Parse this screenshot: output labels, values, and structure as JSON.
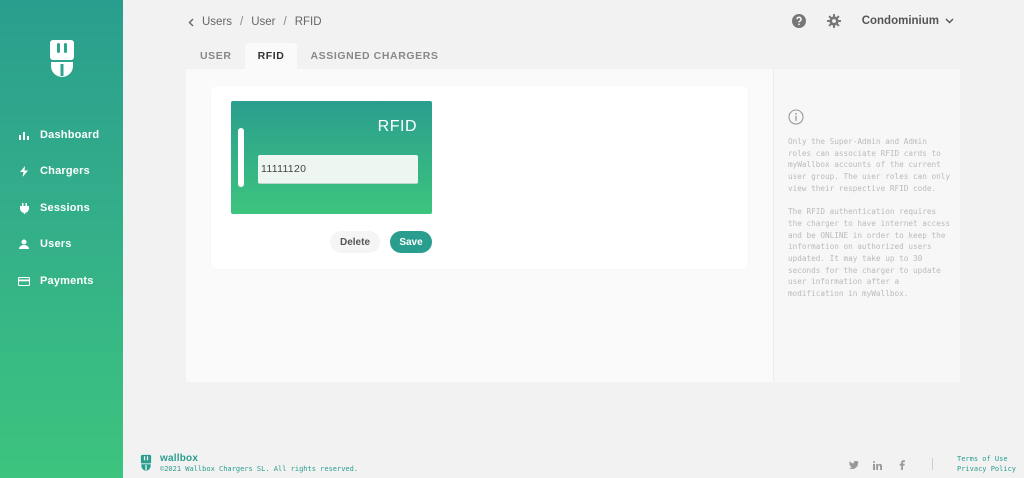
{
  "colors": {
    "brand": "#2a9e8e",
    "brand_light": "#3dc47e",
    "bg": "#f2f2f2"
  },
  "sidebar": {
    "logo_icon": "wallbox-plug-logo",
    "items": [
      {
        "label": "Dashboard",
        "icon": "bar-chart-icon"
      },
      {
        "label": "Chargers",
        "icon": "bolt-icon"
      },
      {
        "label": "Sessions",
        "icon": "plug-icon"
      },
      {
        "label": "Users",
        "icon": "user-icon"
      },
      {
        "label": "Payments",
        "icon": "credit-card-icon"
      }
    ]
  },
  "breadcrumb": {
    "items": [
      "Users",
      "User",
      "RFID"
    ],
    "separator": "/"
  },
  "header": {
    "org_name": "Condominium"
  },
  "tabs": [
    {
      "label": "USER",
      "active": false
    },
    {
      "label": "RFID",
      "active": true
    },
    {
      "label": "ASSIGNED CHARGERS",
      "active": false
    }
  ],
  "rfid": {
    "card_title": "RFID",
    "code_value": "11111120",
    "delete_label": "Delete",
    "save_label": "Save"
  },
  "info": {
    "paragraph1": "Only the Super-Admin and Admin roles can associate RFID cards to myWallbox accounts of the current user group. The user roles can only view their respective RFID code.",
    "paragraph2": "The RFID authentication requires the charger to have internet access and be ONLINE in order to keep the information on authorized users updated. It may take up to 30 seconds for the charger to update user information after a modification in myWallbox."
  },
  "footer": {
    "brand": "wallbox",
    "copyright": "©2021 Wallbox Chargers SL. All rights reserved.",
    "terms": "Terms of Use",
    "privacy": "Privacy Policy",
    "social": [
      "twitter-icon",
      "linkedin-icon",
      "facebook-icon"
    ]
  }
}
